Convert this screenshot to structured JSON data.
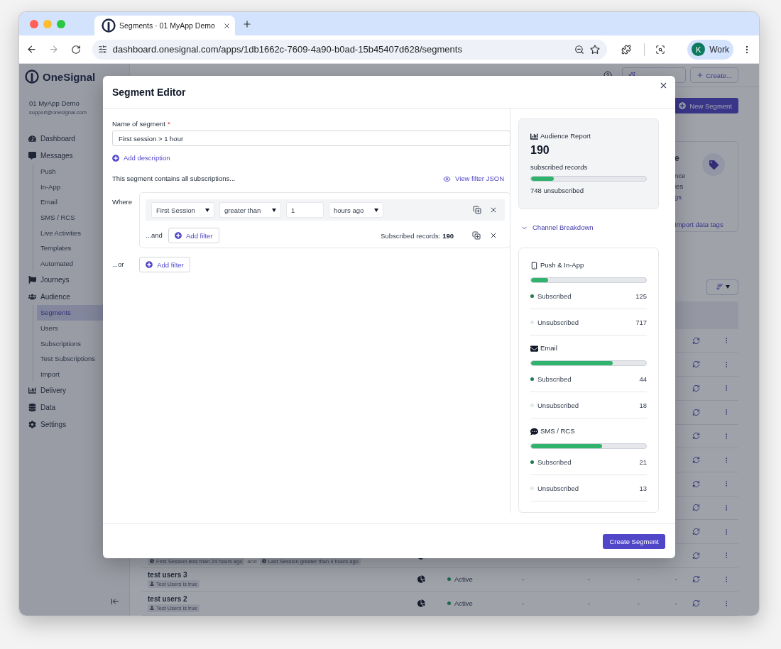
{
  "browser": {
    "tab_title": "Segments · 01 MyApp Demo",
    "url": "dashboard.onesignal.com/apps/1db1662c-7609-4a90-b0ad-15b45407d628/segments",
    "profile_initial": "K",
    "profile_name": "Work"
  },
  "sidebar": {
    "brand": "OneSignal",
    "app_name": "01 MyApp Demo",
    "email": "support@onesignal.com",
    "items": [
      {
        "label": "Dashboard",
        "selected": false
      },
      {
        "label": "Messages",
        "selected": false,
        "children": [
          {
            "label": "Push",
            "selected": false
          },
          {
            "label": "In-App",
            "selected": false
          },
          {
            "label": "Email",
            "selected": false
          },
          {
            "label": "SMS / RCS",
            "selected": false
          },
          {
            "label": "Live Activities",
            "selected": false
          },
          {
            "label": "Templates",
            "selected": false
          },
          {
            "label": "Automated",
            "selected": false
          }
        ]
      },
      {
        "label": "Journeys",
        "selected": false
      },
      {
        "label": "Audience",
        "selected": false,
        "children": [
          {
            "label": "Segments",
            "selected": true
          },
          {
            "label": "Users",
            "selected": false
          },
          {
            "label": "Subscriptions",
            "selected": false
          },
          {
            "label": "Test Subscriptions",
            "selected": false
          },
          {
            "label": "Import",
            "selected": false
          }
        ]
      },
      {
        "label": "Delivery",
        "selected": false
      },
      {
        "label": "Data",
        "selected": false
      },
      {
        "label": "Settings",
        "selected": false
      }
    ]
  },
  "page": {
    "header_buttons": [
      "Create..."
    ],
    "new_segment": "New Segment",
    "card_fragments": [
      "e",
      "nce",
      "ies"
    ],
    "card_link_fragment": "gs",
    "card_link": "Import data tags",
    "rows": [
      {
        "filters": [
          {
            "text": "First Session less than 24 hours ago",
            "kind": "time"
          },
          {
            "text": "Last Session greater than 4 hours ago",
            "kind": "time"
          }
        ],
        "joiner": "and"
      },
      {
        "name": "test users 3",
        "filters": [
          {
            "text": "Test Users is true",
            "kind": "user"
          }
        ],
        "status": "Active",
        "cells": [
          "-",
          "-",
          "-",
          "-"
        ]
      },
      {
        "name": "test users 2",
        "filters": [
          {
            "text": "Test Users is true",
            "kind": "user"
          }
        ],
        "status": "Active",
        "cells": [
          "-",
          "-",
          "-",
          "-"
        ]
      }
    ]
  },
  "modal": {
    "title": "Segment Editor",
    "name_label": "Name of segment",
    "required_mark": "*",
    "name_value": "First session > 1 hour",
    "add_description": "Add description",
    "contains_text": "This segment contains all subscriptions...",
    "view_json": "View filter JSON",
    "where_label": "Where",
    "filter_groups": [
      {
        "filters": [
          {
            "property": "First Session",
            "operator": "greater than",
            "value": "1",
            "unit": "hours ago"
          }
        ],
        "and_label": "...and",
        "add_filter": "Add filter",
        "records": "Subscribed records: **190**"
      }
    ],
    "or_label": "...or",
    "add_filter": "Add filter",
    "report": {
      "title": "Audience Report",
      "total": "190",
      "total_label": "subscribed records",
      "level": 0.2,
      "unsubscribed": "748 unsubscribed"
    },
    "breakdown": {
      "label": "Channel Breakdown",
      "expanded": true,
      "channels": [
        {
          "name": "Push & In-App",
          "kind": "push",
          "level": 0.15,
          "rows": [
            {
              "label": "Subscribed",
              "count": "125",
              "color": "#1e7a52"
            },
            {
              "label": "Unsubscribed",
              "count": "717",
              "color": "#e5e7eb"
            }
          ]
        },
        {
          "name": "Email",
          "kind": "email",
          "level": 0.71,
          "rows": [
            {
              "label": "Subscribed",
              "count": "44",
              "color": "#1e7a52"
            },
            {
              "label": "Unsubscribed",
              "count": "18",
              "color": "#e5e7eb"
            }
          ]
        },
        {
          "name": "SMS / RCS",
          "kind": "sms",
          "level": 0.62,
          "rows": [
            {
              "label": "Subscribed",
              "count": "21",
              "color": "#1e7a52"
            },
            {
              "label": "Unsubscribed",
              "count": "13",
              "color": "#e5e7eb"
            }
          ]
        }
      ]
    },
    "submit": "Create Segment"
  }
}
